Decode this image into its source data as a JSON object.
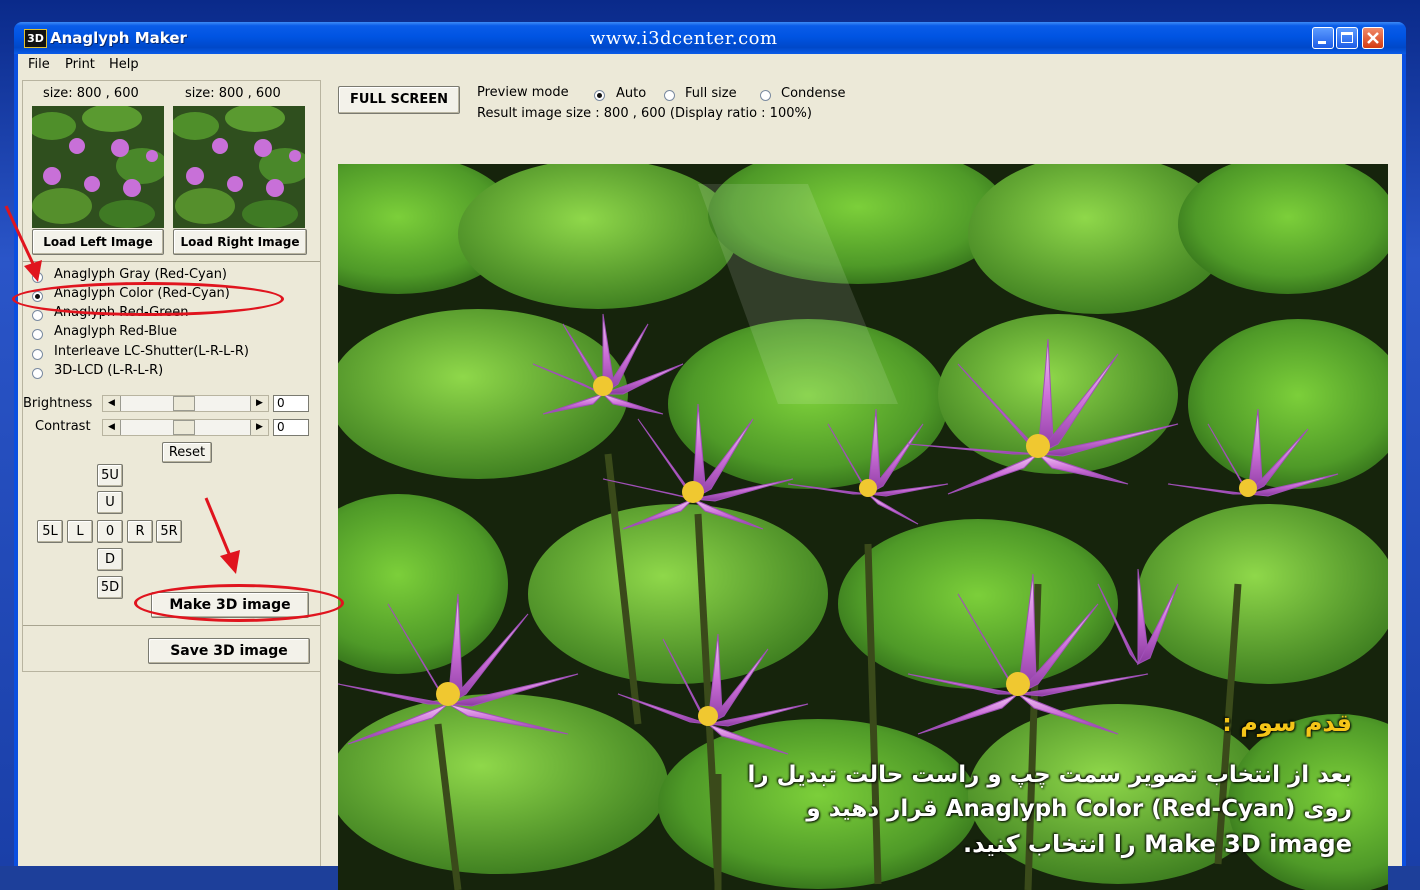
{
  "window": {
    "title": "Anaglyph Maker",
    "logo_text": "3D",
    "url": "www.i3dcenter.com"
  },
  "menu": [
    "File",
    "Print",
    "Help"
  ],
  "left_panel": {
    "left_size": "size: 800 , 600",
    "right_size": "size: 800 , 600",
    "load_left": "Load Left Image",
    "load_right": "Load Right Image",
    "modes": [
      {
        "label": "Anaglyph Gray (Red-Cyan)",
        "selected": false
      },
      {
        "label": "Anaglyph Color (Red-Cyan)",
        "selected": true
      },
      {
        "label": "Anaglyph Red-Green",
        "selected": false
      },
      {
        "label": "Anaglyph Red-Blue",
        "selected": false
      },
      {
        "label": "Interleave LC-Shutter(L-R-L-R)",
        "selected": false
      },
      {
        "label": "3D-LCD (L-R-L-R)",
        "selected": false
      }
    ],
    "brightness_label": "Brightness",
    "brightness_value": "0",
    "contrast_label": "Contrast",
    "contrast_value": "0",
    "reset": "Reset",
    "nav": {
      "up5": "5U",
      "up": "U",
      "left5": "5L",
      "left": "L",
      "center": "0",
      "right": "R",
      "right5": "5R",
      "down": "D",
      "down5": "5D"
    },
    "make": "Make 3D image",
    "save": "Save 3D image"
  },
  "toolbar": {
    "fullscreen": "FULL SCREEN",
    "preview_mode_label": "Preview mode",
    "preview_modes": [
      {
        "label": "Auto",
        "selected": true
      },
      {
        "label": "Full size",
        "selected": false
      },
      {
        "label": "Condense",
        "selected": false
      }
    ],
    "result_text": "Result image size :  800 , 600  (Display ratio : 100%)"
  },
  "overlay": {
    "step_title": "قدم سوم :",
    "line1": "بعد از انتخاب تصویر سمت چپ و راست حالت تبدیل را",
    "line2": "روی (Anaglyph Color (Red-Cyan قرار دهید و",
    "line3": "Make 3D image را انتخاب کنید."
  },
  "colors": {
    "titlebar": "#0054e3",
    "face": "#ece9d8",
    "annotation_red": "#e0141e",
    "step_title": "#f5c518"
  }
}
